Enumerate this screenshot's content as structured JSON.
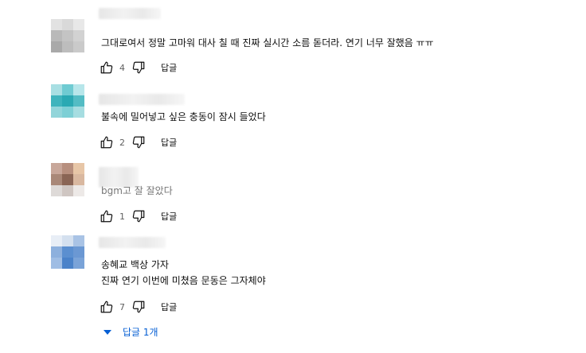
{
  "comments": [
    {
      "text_lines": [
        "그대로여서 정말 고마워 대사 칠 때 진짜 실시간 소름 돋더라. 연기 너무 잘했음 ㅠㅠ"
      ],
      "likes": "4",
      "reply_label": "답글"
    },
    {
      "text_lines": [
        "불속에 밀어넣고 싶은 충동이 잠시 들었다"
      ],
      "likes": "2",
      "reply_label": "답글"
    },
    {
      "text_lines": [
        "bgm고 잘 잘았다"
      ],
      "likes": "1",
      "reply_label": "답글"
    },
    {
      "text_lines": [
        "송혜교 백상 가자",
        "진짜 연기 이번에 미쳤음 문동은 그자체야"
      ],
      "likes": "7",
      "reply_label": "답글"
    }
  ],
  "replies_toggle": {
    "label": "답글 1개"
  },
  "icons": {
    "like": "thumbs-up-icon",
    "dislike": "thumbs-down-icon",
    "expand": "caret-down-icon"
  },
  "colors": {
    "link": "#065fd4",
    "secondary_text": "#606060"
  }
}
